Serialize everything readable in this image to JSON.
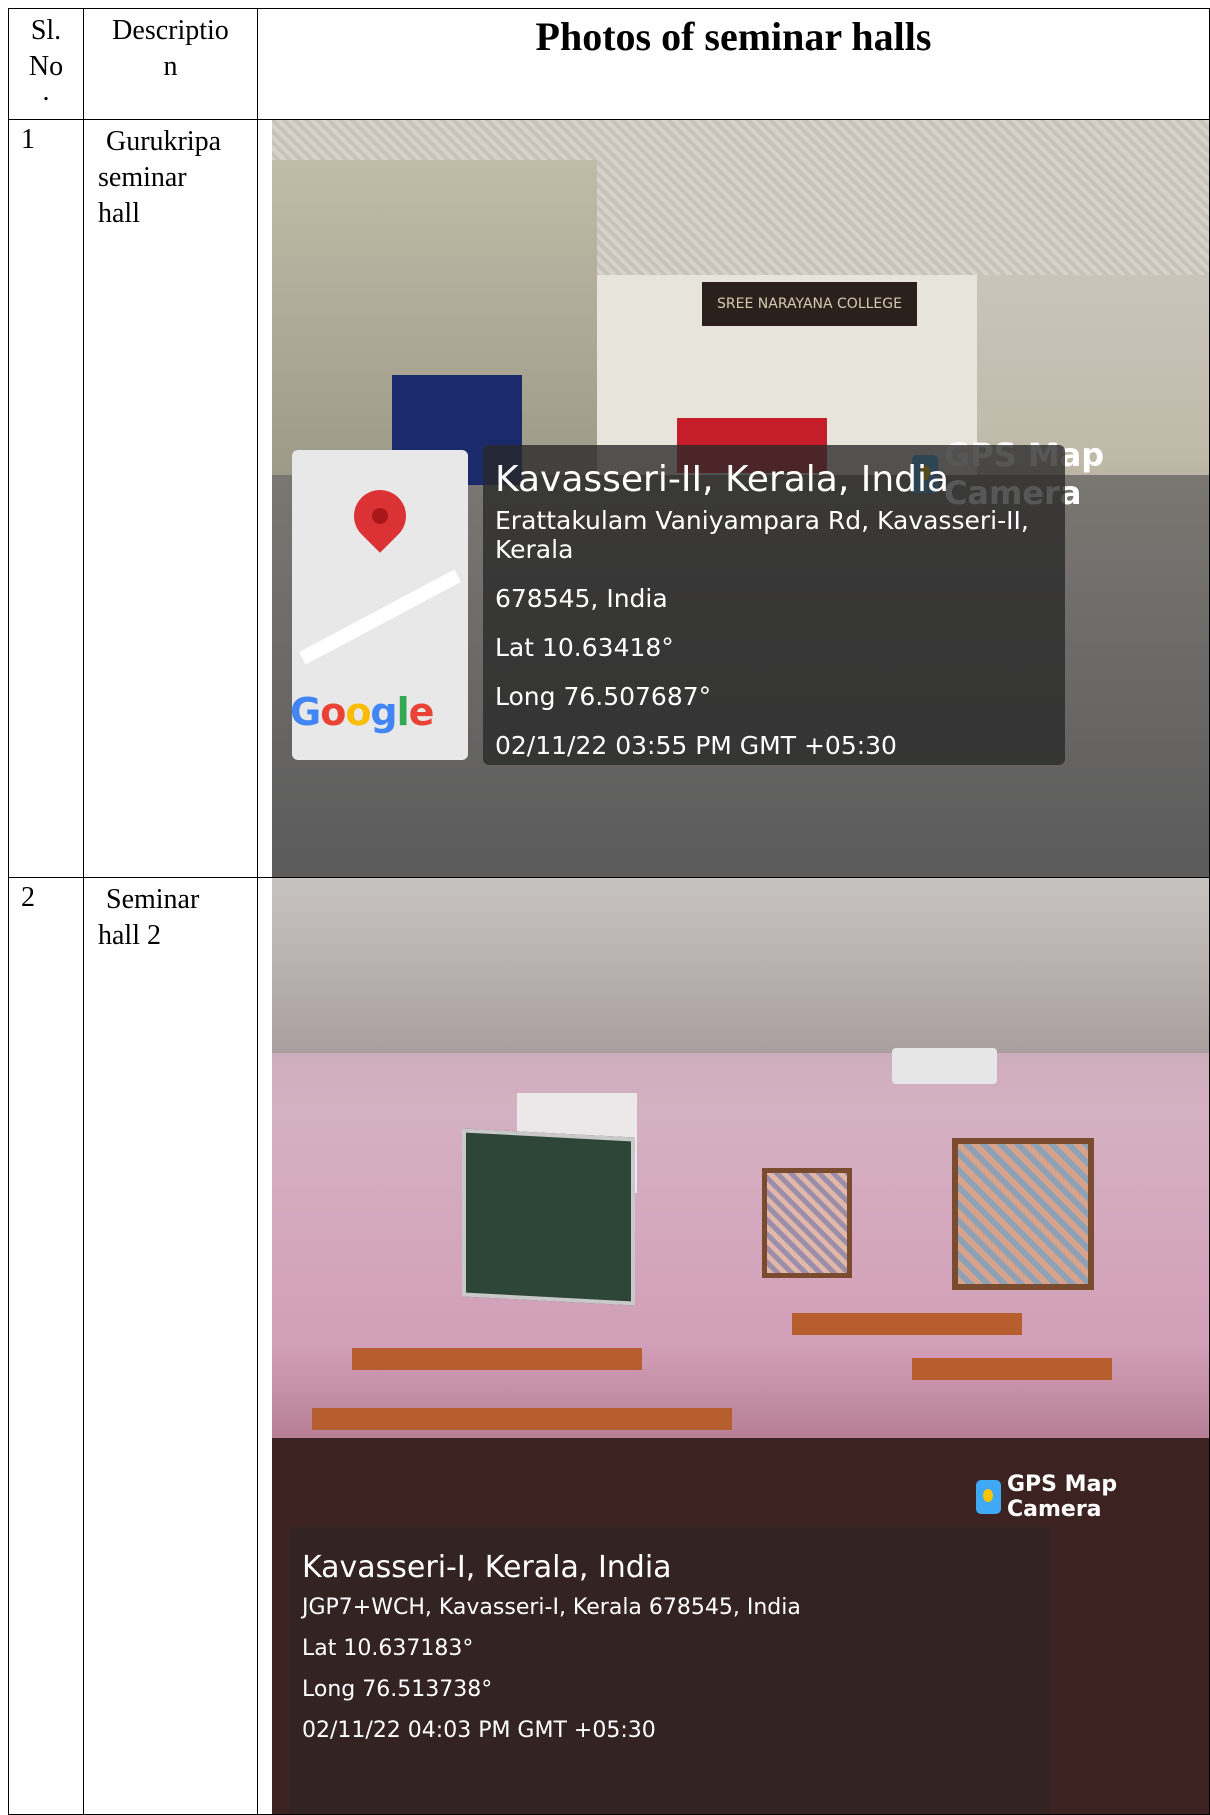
{
  "header": {
    "sl_no": [
      "Sl.",
      "No",
      "."
    ],
    "description": [
      "Descriptio",
      "n"
    ],
    "photos_title": "Photos of seminar halls"
  },
  "rows": [
    {
      "num": "1",
      "desc_lines": [
        "Gurukripa",
        "seminar",
        "hall"
      ],
      "photo": {
        "banner_text": "SREE NARAYANA COLLEGE",
        "badge": "GPS Map Camera",
        "map_logo": "Google",
        "title": "Kavasseri-II, Kerala, India",
        "lines": [
          "Erattakulam Vaniyampara Rd, Kavasseri-II, Kerala",
          "678545, India",
          "Lat 10.63418°",
          "Long 76.507687°",
          "02/11/22 03:55 PM GMT +05:30"
        ]
      }
    },
    {
      "num": "2",
      "desc_lines": [
        "Seminar",
        "hall 2"
      ],
      "photo": {
        "badge": "GPS Map Camera",
        "title": "Kavasseri-I, Kerala, India",
        "lines": [
          "JGP7+WCH, Kavasseri-I, Kerala 678545, India",
          "Lat 10.637183°",
          "Long 76.513738°",
          "02/11/22 04:03 PM GMT +05:30"
        ]
      }
    }
  ],
  "icons": {
    "gps_badge_icon": "gps-map-camera-icon",
    "map_pin": "map-pin-icon"
  },
  "colors": {
    "pin": "#db3236",
    "badge_icon": "#3fa9f5"
  }
}
